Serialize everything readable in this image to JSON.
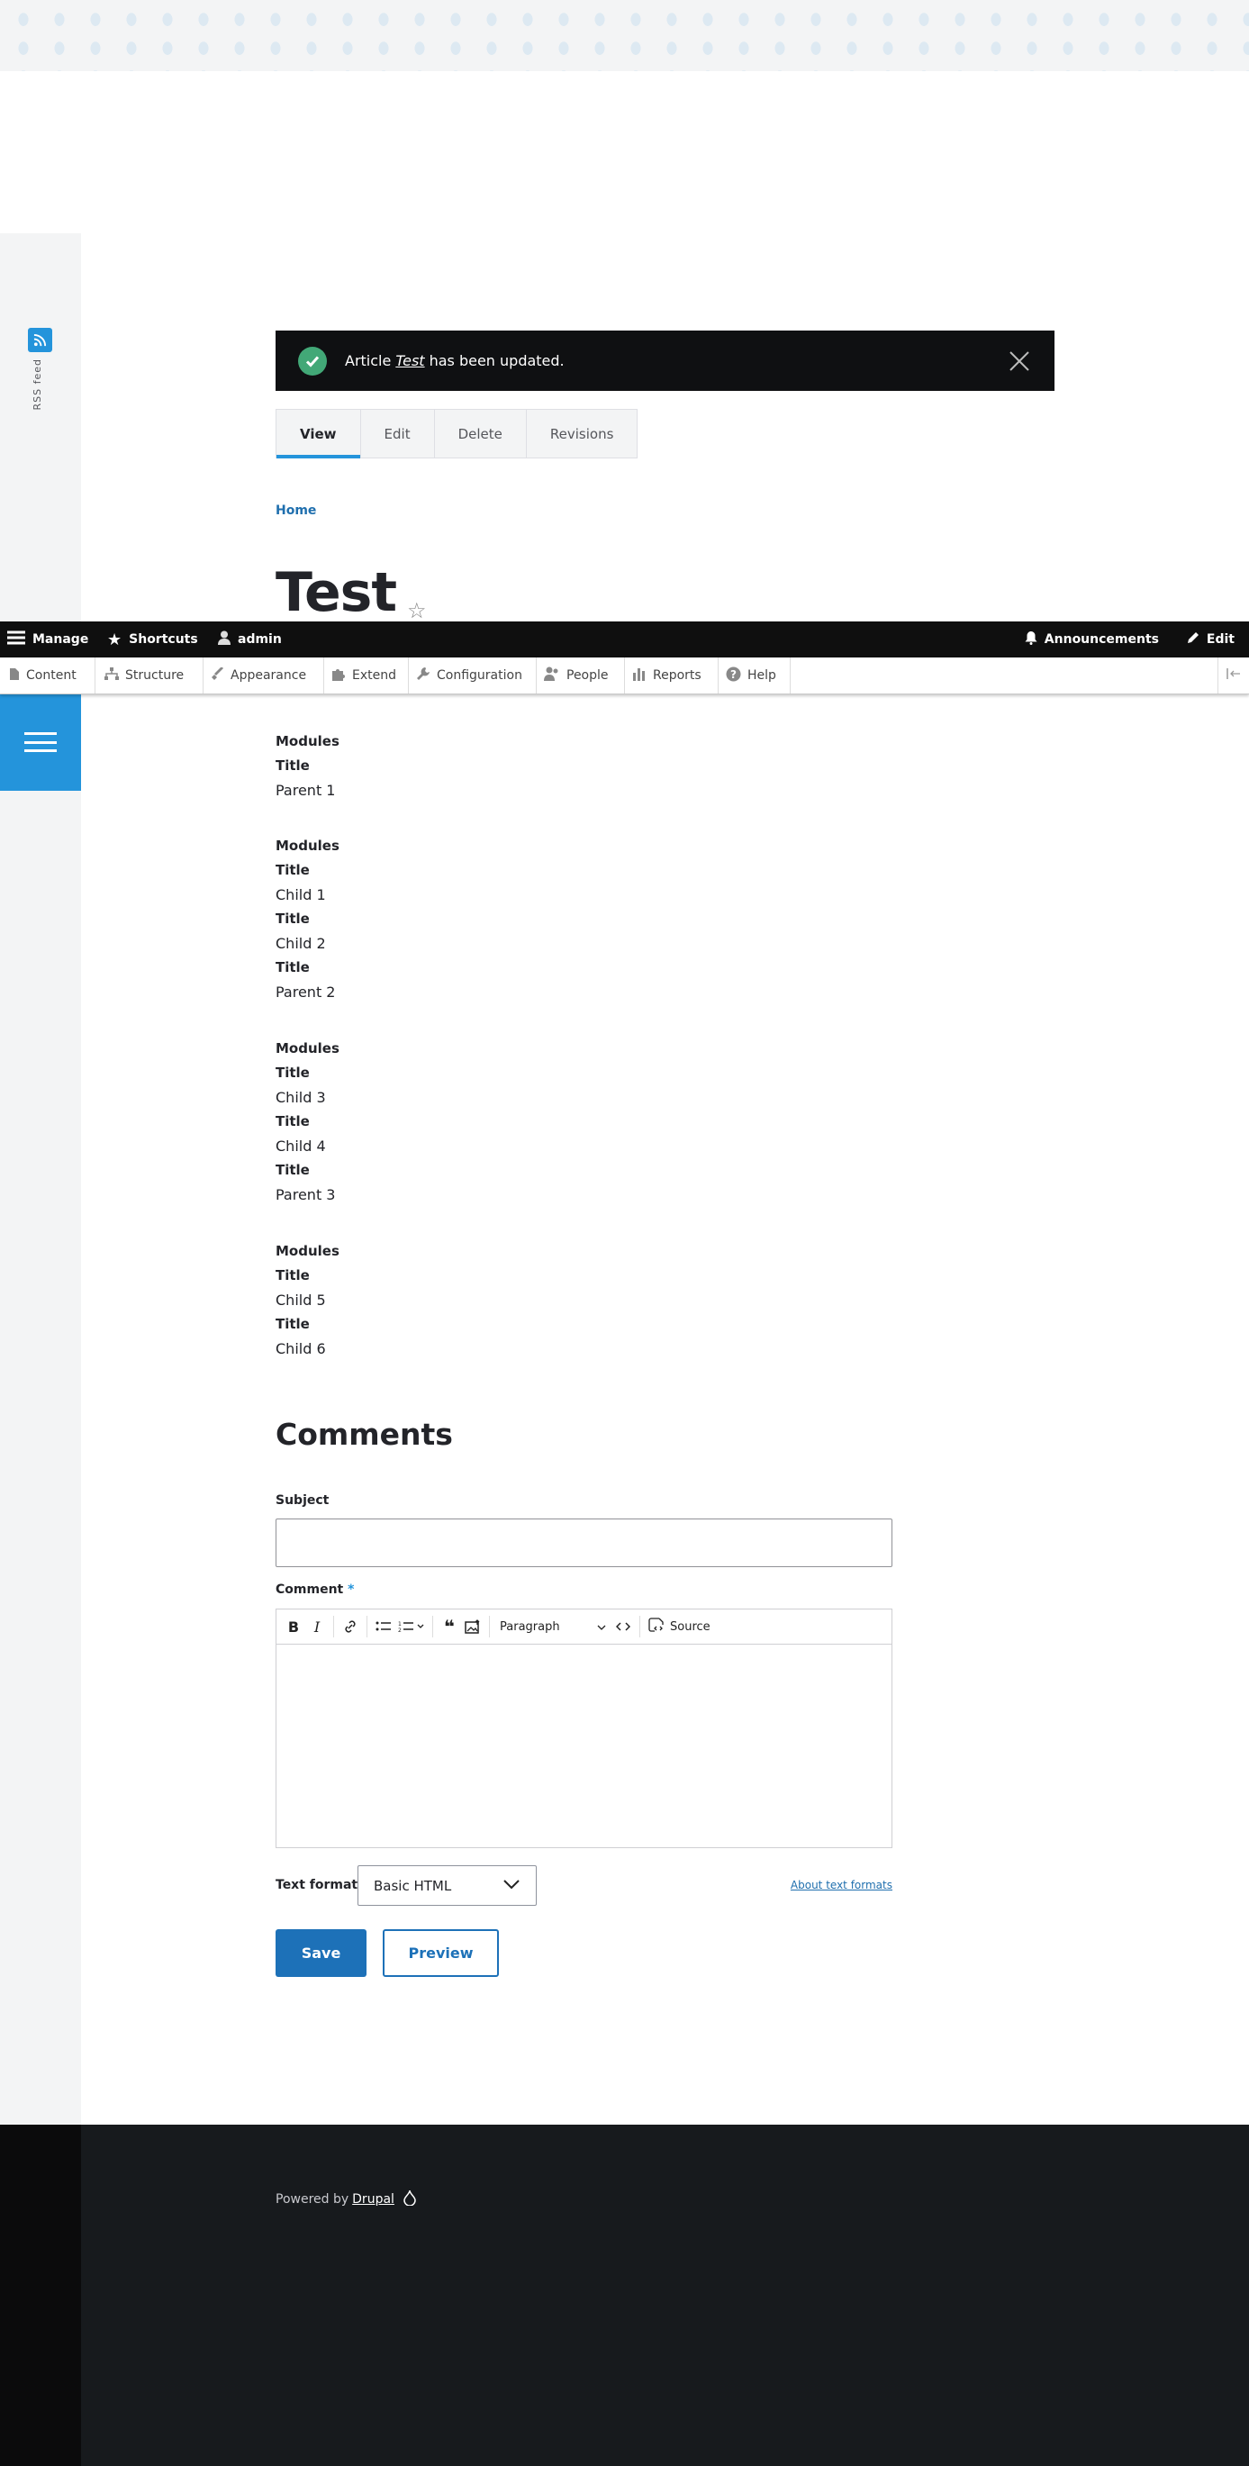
{
  "sidebar": {
    "rss_label": "RSS feed"
  },
  "message": {
    "prefix": "Article",
    "title": "Test",
    "suffix": "has been updated."
  },
  "tabs": [
    {
      "label": "View",
      "active": true
    },
    {
      "label": "Edit",
      "active": false
    },
    {
      "label": "Delete",
      "active": false
    },
    {
      "label": "Revisions",
      "active": false
    }
  ],
  "breadcrumb": {
    "home": "Home"
  },
  "page": {
    "title": "Test"
  },
  "toolbar": {
    "manage": "Manage",
    "shortcuts": "Shortcuts",
    "user": "admin",
    "announcements": "Announcements",
    "edit": "Edit"
  },
  "tray": {
    "content": "Content",
    "structure": "Structure",
    "appearance": "Appearance",
    "extend": "Extend",
    "configuration": "Configuration",
    "people": "People",
    "reports": "Reports",
    "help": "Help"
  },
  "article": {
    "g1": {
      "h": "Modules",
      "t1": "Title",
      "v1": "Parent 1"
    },
    "g2": {
      "h": "Modules",
      "t1": "Title",
      "v1": "Child 1",
      "t2": "Title",
      "v2": "Child 2",
      "t3": "Title",
      "v3": "Parent 2"
    },
    "g3": {
      "h": "Modules",
      "t1": "Title",
      "v1": "Child 3",
      "t2": "Title",
      "v2": "Child 4",
      "t3": "Title",
      "v3": "Parent 3"
    },
    "g4": {
      "h": "Modules",
      "t1": "Title",
      "v1": "Child 5",
      "t2": "Title",
      "v2": "Child 6"
    }
  },
  "comments": {
    "heading": "Comments",
    "subject_label": "Subject",
    "subject_value": "",
    "comment_label": "Comment",
    "required_mark": "*",
    "paragraph": "Paragraph",
    "source": "Source",
    "format_label": "Text format",
    "format_value": "Basic HTML",
    "about_link": "About text formats",
    "save": "Save",
    "preview": "Preview"
  },
  "footer": {
    "powered": "Powered by",
    "drupal": "Drupal"
  },
  "colors": {
    "accent": "#2494db",
    "primary_button": "#1d71b8",
    "success": "#42a877"
  }
}
